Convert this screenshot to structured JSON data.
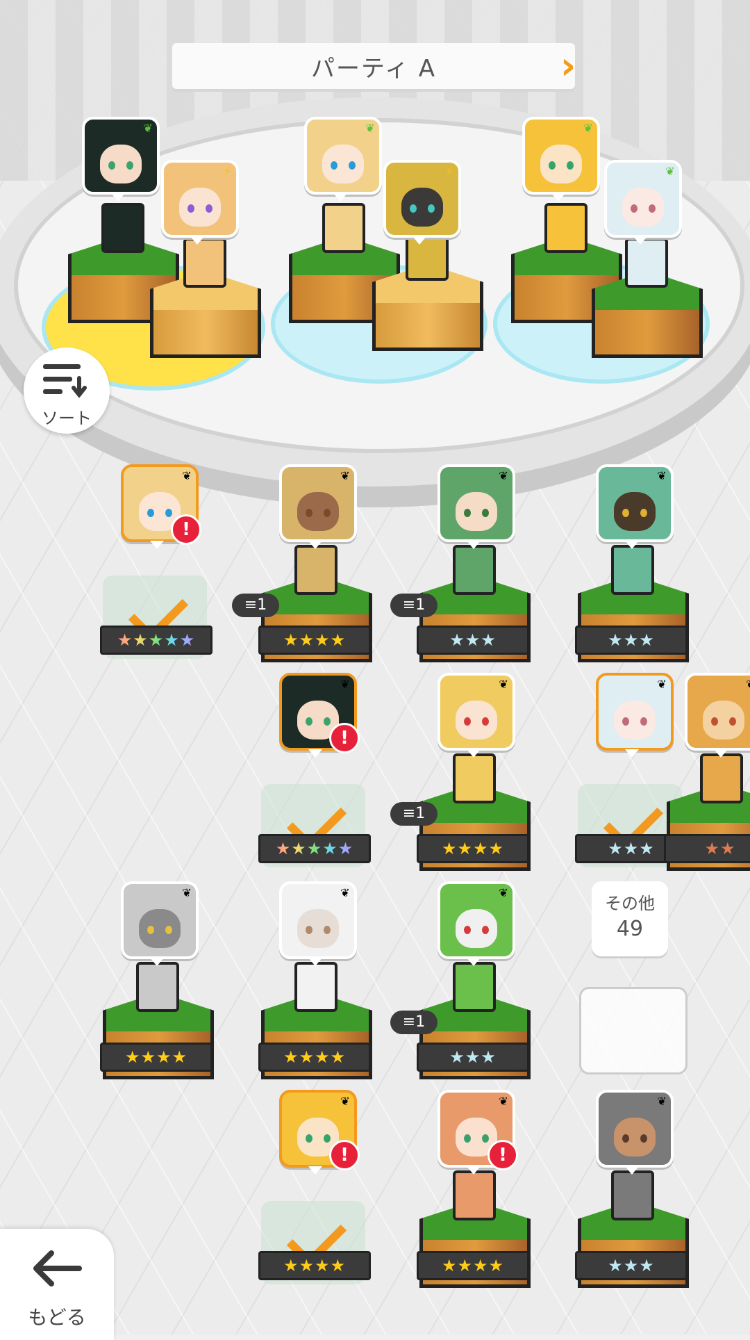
{
  "header": {
    "title": "パーティ A"
  },
  "sort": {
    "label": "ソート"
  },
  "back": {
    "label": "もどる"
  },
  "other": {
    "label": "その他",
    "count": "49"
  },
  "party": [
    {
      "hair": "#1d2b26",
      "skin": "#f6dcc8",
      "eye": "#3ba36b",
      "element": "leaf"
    },
    {
      "hair": "#f2c27a",
      "skin": "#fbe3d2",
      "eye": "#8c5bd6",
      "element": "bolt"
    },
    {
      "hair": "#f2d28a",
      "skin": "#fbe6d6",
      "eye": "#2a9bd6",
      "element": "leaf"
    },
    {
      "hair": "#d9b640",
      "skin": "#3b3a38",
      "eye": "#46c8c0",
      "element": "bolt"
    },
    {
      "hair": "#f5c23a",
      "skin": "#fbe3c6",
      "eye": "#34a56a",
      "element": "leaf"
    },
    {
      "hair": "#dfeef3",
      "skin": "#fbe9e4",
      "eye": "#c06a7a",
      "element": "leaf"
    }
  ],
  "roster": [
    {
      "hair": "#f2d28a",
      "skin": "#fbe6d6",
      "eye": "#2a9bd6",
      "stars": "★★★★★",
      "tier": "rainbow",
      "selected": true,
      "alert": true,
      "dup": ""
    },
    {
      "hair": "#d8b46a",
      "skin": "#9a6a4a",
      "eye": "#7a4a2a",
      "stars": "★★★★",
      "tier": "gold",
      "selected": false,
      "alert": false,
      "dup": "1"
    },
    {
      "hair": "#5fa56a",
      "skin": "#f4dcc6",
      "eye": "#3a7a3a",
      "stars": "★★★",
      "tier": "silver",
      "selected": false,
      "alert": false,
      "dup": "1"
    },
    {
      "hair": "#6ab89a",
      "skin": "#4a3a2a",
      "eye": "#e0b030",
      "stars": "★★★",
      "tier": "silver",
      "selected": false,
      "alert": false,
      "dup": ""
    },
    {
      "hair": "#1d2b26",
      "skin": "#f6dcc8",
      "eye": "#3ba36b",
      "stars": "★★★★★",
      "tier": "rainbow",
      "selected": true,
      "alert": true,
      "dup": ""
    },
    {
      "hair": "#f0cc60",
      "skin": "#fbe3d2",
      "eye": "#d63a3a",
      "stars": "★★★★",
      "tier": "gold",
      "selected": false,
      "alert": false,
      "dup": "1"
    },
    {
      "hair": "#dfeef3",
      "skin": "#fbe9e4",
      "eye": "#c06a7a",
      "stars": "★★★",
      "tier": "silver",
      "selected": true,
      "alert": false,
      "dup": ""
    },
    {
      "hair": "#e6a84a",
      "skin": "#f3d1a0",
      "eye": "#c05030",
      "stars": "★★",
      "tier": "bronze",
      "selected": false,
      "alert": false,
      "dup": ""
    },
    {
      "hair": "#c9c9c9",
      "skin": "#8a8a8a",
      "eye": "#e8c040",
      "stars": "★★★★",
      "tier": "gold",
      "selected": false,
      "alert": false,
      "dup": ""
    },
    {
      "hair": "#f2f2f2",
      "skin": "#e6ded6",
      "eye": "#b08a6a",
      "stars": "★★★★",
      "tier": "gold",
      "selected": false,
      "alert": false,
      "dup": ""
    },
    {
      "hair": "#6ac04a",
      "skin": "#f0f0f0",
      "eye": "#d63a3a",
      "stars": "★★★",
      "tier": "silver",
      "selected": false,
      "alert": false,
      "dup": "1"
    },
    {
      "hair": "#f5c23a",
      "skin": "#fbe3c6",
      "eye": "#34a56a",
      "stars": "★★★★",
      "tier": "gold",
      "selected": true,
      "alert": true,
      "dup": ""
    },
    {
      "hair": "#e89a6a",
      "skin": "#fbe0cf",
      "eye": "#3aa06a",
      "stars": "★★★★",
      "tier": "gold",
      "selected": false,
      "alert": true,
      "dup": ""
    },
    {
      "hair": "#7a7a7a",
      "skin": "#c8926a",
      "eye": "#5a3a2a",
      "stars": "★★★",
      "tier": "silver",
      "selected": false,
      "alert": false,
      "dup": ""
    }
  ]
}
